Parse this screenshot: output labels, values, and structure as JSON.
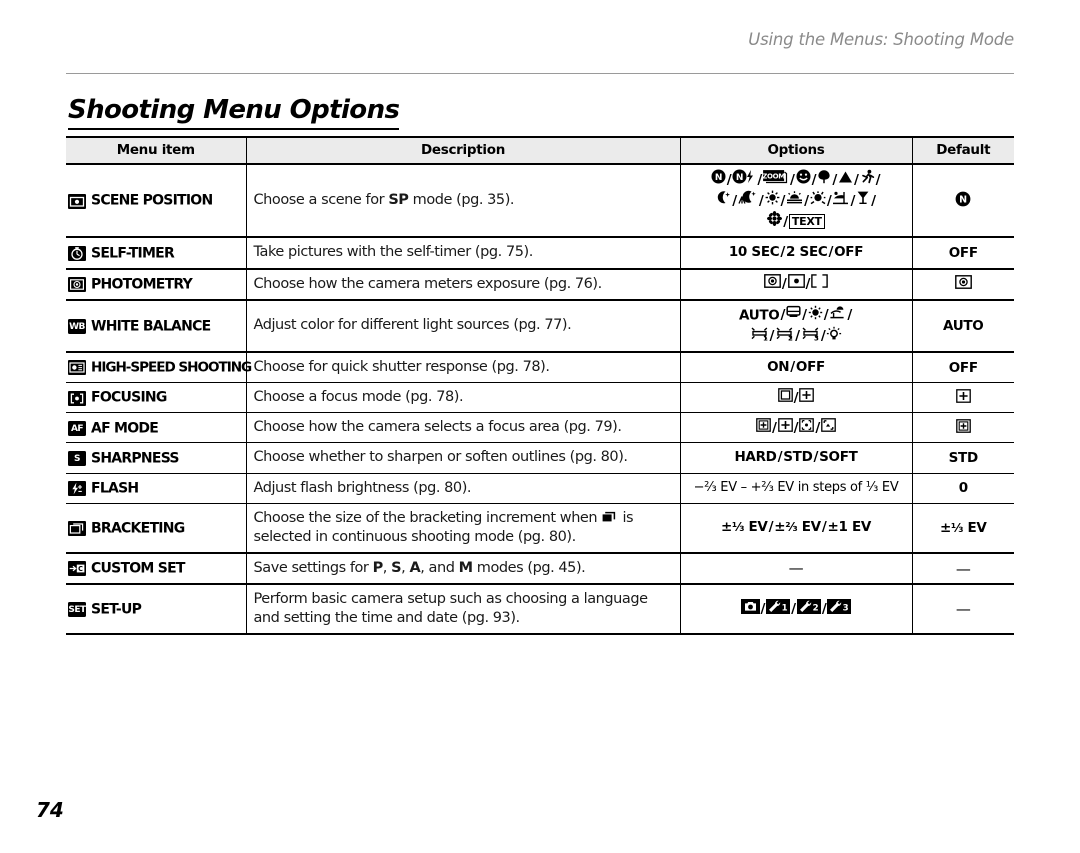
{
  "page": {
    "running_header": "Using the Menus: Shooting Mode",
    "section_title": "Shooting Menu Options",
    "page_number": "74"
  },
  "table": {
    "headers": {
      "menu_item": "Menu item",
      "description": "Description",
      "options": "Options",
      "default": "Default"
    },
    "rows": [
      {
        "icon": "scene-position-icon",
        "label": "SCENE POSITION",
        "description_pre": "Choose a scene for ",
        "description_bold": "SP",
        "description_post": " mode (pg. 35).",
        "options_text": "Natural Light / Natural Light & Flash / ZOOM / Portrait / Flower / Landscape / Sport / Night / Night (Tripod) / Fireworks / Sunset / Snow / Beach / Party / Flower / TEXT",
        "default_text": "Natural Light"
      },
      {
        "icon": "self-timer-icon",
        "label": "SELF-TIMER",
        "description": "Take pictures with the self-timer (pg. 75).",
        "options_text": "10 SEC / 2 SEC / OFF",
        "default_text": "OFF"
      },
      {
        "icon": "photometry-icon",
        "label": "PHOTOMETRY",
        "description": "Choose how the camera meters exposure (pg. 76).",
        "options_text": "Multi / Spot / Average",
        "default_text": "Multi"
      },
      {
        "icon": "white-balance-icon",
        "label": "WHITE BALANCE",
        "description": "Adjust color for different light sources (pg. 77).",
        "options_text": "AUTO / Custom / Daylight / Shade / Fluorescent 1 / Fluorescent 2 / Fluorescent 3 / Incandescent",
        "default_text": "AUTO"
      },
      {
        "icon": "high-speed-shooting-icon",
        "label": "HIGH-SPEED SHOOTING",
        "description": "Choose for quick shutter response (pg. 78).",
        "options_text": "ON / OFF",
        "default_text": "OFF"
      },
      {
        "icon": "focusing-icon",
        "label": "FOCUSING",
        "description": "Choose a focus mode (pg. 78).",
        "options_text": "Area / Center",
        "default_text": "Center"
      },
      {
        "icon": "af-mode-icon",
        "label": "AF MODE",
        "description": "Choose how the camera selects a focus area (pg. 79).",
        "options_text": "Center / Multi / Area / Tracking",
        "default_text": "Center"
      },
      {
        "icon": "sharpness-icon",
        "label": "SHARPNESS",
        "description": "Choose whether to sharpen or soften outlines (pg. 80).",
        "options_text": "HARD / STD / SOFT",
        "default_text": "STD"
      },
      {
        "icon": "flash-icon",
        "label": "FLASH",
        "description": "Adjust flash brightness (pg. 80).",
        "options_text": "−⅔ EV – +⅔ EV in steps of ⅓ EV",
        "default_text": "0"
      },
      {
        "icon": "bracketing-icon",
        "label": "BRACKETING",
        "description_pre": "Choose the size of the bracketing increment when ",
        "description_post": " is selected in continuous shooting mode (pg. 80).",
        "options_text": "±⅓ EV / ±⅔ EV / ±1 EV",
        "default_text": "±⅓ EV"
      },
      {
        "icon": "custom-set-icon",
        "label": "CUSTOM SET",
        "description_parts": [
          "Save settings for ",
          "P",
          ", ",
          "S",
          ", ",
          "A",
          ", and ",
          "M",
          " modes (pg. 45)."
        ],
        "options_text": "—",
        "default_text": "—"
      },
      {
        "icon": "set-up-icon",
        "label": "SET-UP",
        "description": "Perform basic camera setup such as choosing a language and setting the time and date (pg. 93).",
        "options_text": "Camera / Wrench 1 / Wrench 2 / Wrench 3",
        "default_text": "—"
      }
    ]
  },
  "labels": {
    "flash_text": "EV – +",
    "flash_lead": "−",
    "flash_tail": "EV in steps of",
    "ev": "EV",
    "two_thirds": "⅔",
    "one_third": "⅓",
    "plusminus": "±",
    "one_ev": "±1 EV",
    "dash": "—",
    "slash": "/",
    "auto": "AUTO",
    "on": "ON",
    "off": "OFF",
    "ten_sec": "10 SEC",
    "two_sec": "2 SEC",
    "hard": "HARD",
    "std": "STD",
    "soft": "SOFT",
    "zero": "0",
    "sp": "SP",
    "text_badge": "TEXT",
    "wb_badge": "WB",
    "af_badge": "AF",
    "c_badge": "C",
    "set_badge": "SET",
    "s_badge": "S",
    "wrench1": "1",
    "wrench2": "2",
    "wrench3": "3"
  },
  "colors": {
    "ink": "#000000",
    "header_gray": "#8a8a8a",
    "table_header_bg": "#ebebeb",
    "body_text": "#1a1a1a"
  }
}
